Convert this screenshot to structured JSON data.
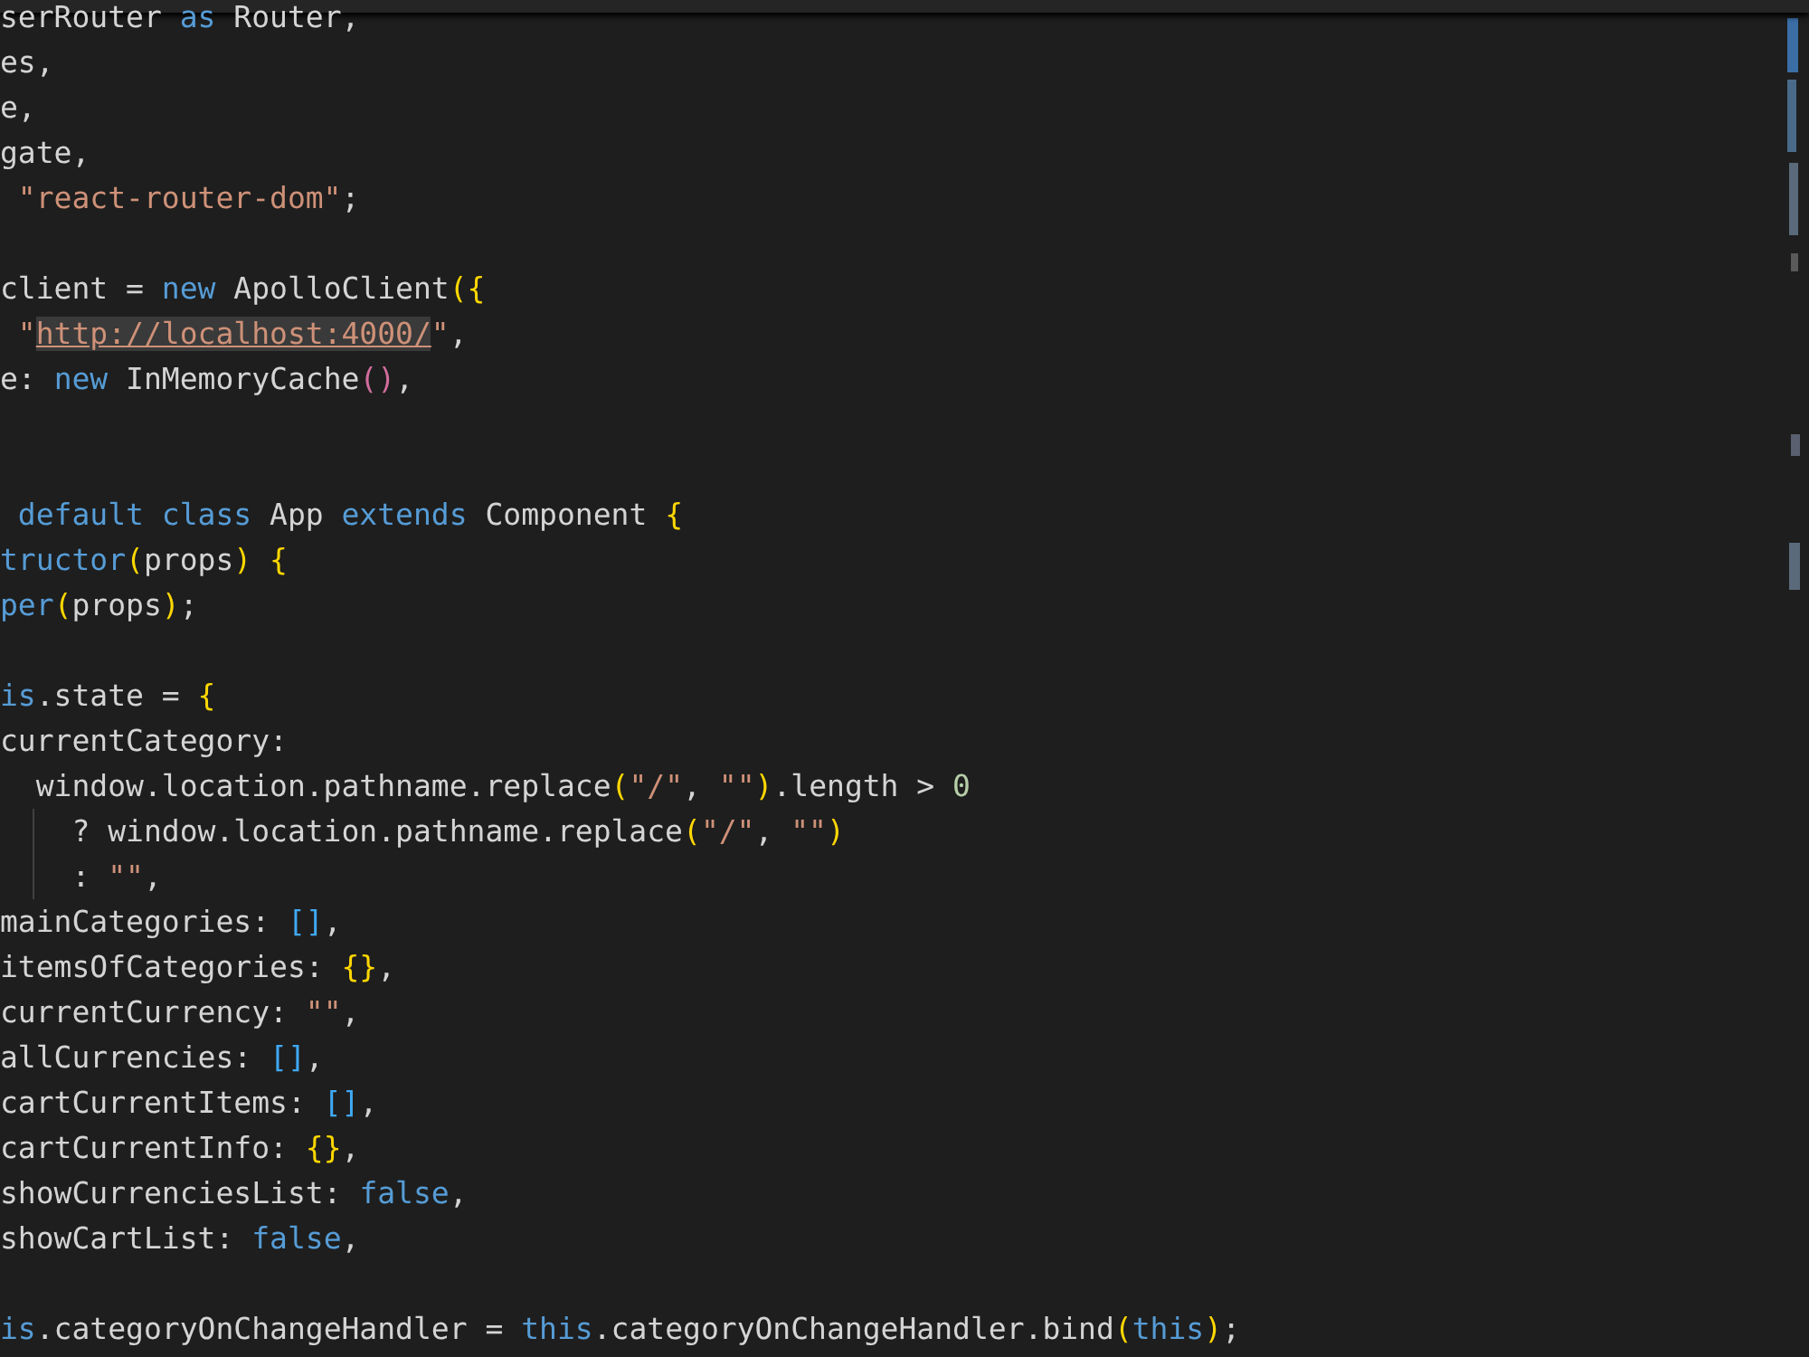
{
  "editor": {
    "lines": [
      {
        "indent_guide": false,
        "tokens": [
          {
            "kind": "plain",
            "text": "serRouter "
          },
          {
            "kind": "keyword",
            "text": "as"
          },
          {
            "kind": "plain",
            "text": " Router,"
          }
        ]
      },
      {
        "indent_guide": false,
        "tokens": [
          {
            "kind": "plain",
            "text": "es,"
          }
        ]
      },
      {
        "indent_guide": false,
        "tokens": [
          {
            "kind": "plain",
            "text": "e,"
          }
        ]
      },
      {
        "indent_guide": false,
        "tokens": [
          {
            "kind": "plain",
            "text": "gate,"
          }
        ]
      },
      {
        "indent_guide": false,
        "tokens": [
          {
            "kind": "string",
            "text": " \"react-router-dom\""
          },
          {
            "kind": "plain",
            "text": ";"
          }
        ]
      },
      {
        "indent_guide": false
      },
      {
        "indent_guide": false,
        "tokens": [
          {
            "kind": "plain",
            "text": "client = "
          },
          {
            "kind": "keyword",
            "text": "new"
          },
          {
            "kind": "plain",
            "text": " ApolloClient"
          },
          {
            "kind": "bracket1",
            "text": "({"
          }
        ]
      },
      {
        "indent_guide": false,
        "tokens": [
          {
            "kind": "string",
            "text": " \""
          },
          {
            "kind": "link",
            "text": "http://localhost:4000/"
          },
          {
            "kind": "string",
            "text": "\""
          },
          {
            "kind": "plain",
            "text": ","
          }
        ]
      },
      {
        "indent_guide": false,
        "tokens": [
          {
            "kind": "plain",
            "text": "e: "
          },
          {
            "kind": "keyword",
            "text": "new"
          },
          {
            "kind": "plain",
            "text": " InMemoryCache"
          },
          {
            "kind": "bracket2",
            "text": "()"
          },
          {
            "kind": "plain",
            "text": ","
          }
        ]
      },
      {
        "indent_guide": false
      },
      {
        "indent_guide": false
      },
      {
        "indent_guide": false,
        "tokens": [
          {
            "kind": "keyword",
            "text": " default class"
          },
          {
            "kind": "plain",
            "text": " App "
          },
          {
            "kind": "keyword",
            "text": "extends"
          },
          {
            "kind": "plain",
            "text": " Component "
          },
          {
            "kind": "bracket1",
            "text": "{"
          }
        ]
      },
      {
        "indent_guide": false,
        "tokens": [
          {
            "kind": "keyword",
            "text": "tructor"
          },
          {
            "kind": "bracket1",
            "text": "("
          },
          {
            "kind": "plain",
            "text": "props"
          },
          {
            "kind": "bracket1",
            "text": ") {"
          }
        ]
      },
      {
        "indent_guide": false,
        "tokens": [
          {
            "kind": "keyword",
            "text": "per"
          },
          {
            "kind": "bracket1",
            "text": "("
          },
          {
            "kind": "plain",
            "text": "props"
          },
          {
            "kind": "bracket1",
            "text": ")"
          },
          {
            "kind": "plain",
            "text": ";"
          }
        ]
      },
      {
        "indent_guide": false
      },
      {
        "indent_guide": false,
        "tokens": [
          {
            "kind": "keyword",
            "text": "is"
          },
          {
            "kind": "plain",
            "text": ".state = "
          },
          {
            "kind": "bracket1",
            "text": "{"
          }
        ]
      },
      {
        "indent_guide": false,
        "tokens": [
          {
            "kind": "plain",
            "text": "currentCategory:"
          }
        ]
      },
      {
        "indent_guide": false,
        "tokens": [
          {
            "kind": "plain",
            "text": "  window.location.pathname.replace"
          },
          {
            "kind": "bracket1",
            "text": "("
          },
          {
            "kind": "string",
            "text": "\"/\""
          },
          {
            "kind": "plain",
            "text": ", "
          },
          {
            "kind": "string",
            "text": "\"\""
          },
          {
            "kind": "bracket1",
            "text": ")"
          },
          {
            "kind": "plain",
            "text": ".length > "
          },
          {
            "kind": "number",
            "text": "0"
          }
        ]
      },
      {
        "indent_guide": true,
        "tokens": [
          {
            "kind": "plain",
            "text": "    ? window.location.pathname.replace"
          },
          {
            "kind": "bracket1",
            "text": "("
          },
          {
            "kind": "string",
            "text": "\"/\""
          },
          {
            "kind": "plain",
            "text": ", "
          },
          {
            "kind": "string",
            "text": "\"\""
          },
          {
            "kind": "bracket1",
            "text": ")"
          }
        ]
      },
      {
        "indent_guide": true,
        "tokens": [
          {
            "kind": "plain",
            "text": "    : "
          },
          {
            "kind": "string",
            "text": "\"\""
          },
          {
            "kind": "plain",
            "text": ","
          }
        ]
      },
      {
        "indent_guide": false,
        "tokens": [
          {
            "kind": "plain",
            "text": "mainCategories: "
          },
          {
            "kind": "bracket3",
            "text": "[]"
          },
          {
            "kind": "plain",
            "text": ","
          }
        ]
      },
      {
        "indent_guide": false,
        "tokens": [
          {
            "kind": "plain",
            "text": "itemsOfCategories: "
          },
          {
            "kind": "bracket1",
            "text": "{}"
          },
          {
            "kind": "plain",
            "text": ","
          }
        ]
      },
      {
        "indent_guide": false,
        "tokens": [
          {
            "kind": "plain",
            "text": "currentCurrency: "
          },
          {
            "kind": "string",
            "text": "\"\""
          },
          {
            "kind": "plain",
            "text": ","
          }
        ]
      },
      {
        "indent_guide": false,
        "tokens": [
          {
            "kind": "plain",
            "text": "allCurrencies: "
          },
          {
            "kind": "bracket3",
            "text": "[]"
          },
          {
            "kind": "plain",
            "text": ","
          }
        ]
      },
      {
        "indent_guide": false,
        "tokens": [
          {
            "kind": "plain",
            "text": "cartCurrentItems: "
          },
          {
            "kind": "bracket3",
            "text": "[]"
          },
          {
            "kind": "plain",
            "text": ","
          }
        ]
      },
      {
        "indent_guide": false,
        "tokens": [
          {
            "kind": "plain",
            "text": "cartCurrentInfo: "
          },
          {
            "kind": "bracket1",
            "text": "{}"
          },
          {
            "kind": "plain",
            "text": ","
          }
        ]
      },
      {
        "indent_guide": false,
        "tokens": [
          {
            "kind": "plain",
            "text": "showCurrenciesList: "
          },
          {
            "kind": "keyword",
            "text": "false"
          },
          {
            "kind": "plain",
            "text": ","
          }
        ]
      },
      {
        "indent_guide": false,
        "tokens": [
          {
            "kind": "plain",
            "text": "showCartList: "
          },
          {
            "kind": "keyword",
            "text": "false"
          },
          {
            "kind": "plain",
            "text": ","
          }
        ]
      },
      {
        "indent_guide": false
      },
      {
        "indent_guide": false,
        "tokens": [
          {
            "kind": "keyword",
            "text": "is"
          },
          {
            "kind": "plain",
            "text": ".categoryOnChangeHandler = "
          },
          {
            "kind": "keyword",
            "text": "this"
          },
          {
            "kind": "plain",
            "text": ".categoryOnChangeHandler.bind"
          },
          {
            "kind": "bracket1",
            "text": "("
          },
          {
            "kind": "keyword",
            "text": "this"
          },
          {
            "kind": "bracket1",
            "text": ")"
          },
          {
            "kind": "plain",
            "text": ";"
          }
        ]
      }
    ]
  }
}
